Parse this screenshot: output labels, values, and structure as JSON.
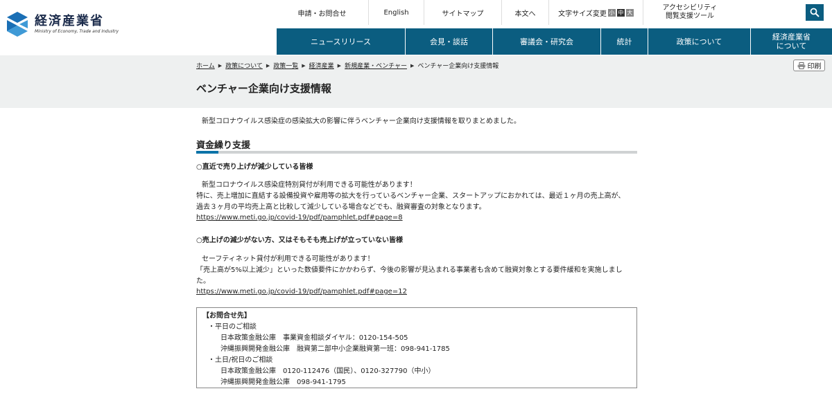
{
  "header": {
    "logo_ja": "経済産業省",
    "logo_en": "Ministry of Economy, Trade and Industry",
    "brand_color": "#0b5d80",
    "top_links": [
      {
        "label": "申請・お問合せ"
      },
      {
        "label": "English"
      },
      {
        "label": "サイトマップ"
      },
      {
        "label": "本文へ"
      }
    ],
    "font_size_label": "文字サイズ変更",
    "font_sizes": [
      "小",
      "中",
      "大"
    ],
    "accessibility_line1": "アクセシビリティ",
    "accessibility_line2": "閲覧支援ツール",
    "search_icon": "search-icon"
  },
  "main_nav": {
    "items": [
      {
        "label": "ニュースリリース"
      },
      {
        "label": "会見・談話"
      },
      {
        "label": "審議会・研究会"
      },
      {
        "label": "統計"
      },
      {
        "label": "政策について"
      },
      {
        "label_line1": "経済産業省",
        "label_line2": "について"
      }
    ]
  },
  "breadcrumb": {
    "items": [
      "ホーム",
      "政策について",
      "政策一覧",
      "経済産業",
      "新規産業・ベンチャー"
    ],
    "current": "ベンチャー企業向け支援情報"
  },
  "print_label": "印刷",
  "page_title": "ベンチャー企業向け支援情報",
  "lead": "新型コロナウイルス感染症の感染拡大の影響に伴うベンチャー企業向け支援情報を取りまとめました。",
  "section": {
    "title": "資金繰り支援",
    "block1": {
      "heading": "○直近で売り上げが減少している皆様",
      "line1": "新型コロナウイルス感染症特別貸付が利用できる可能性があります！",
      "line2": "特に、売上増加に直結する設備投資や雇用等の拡大を行っているベンチャー企業、スタートアップにおかれては、最近１ヶ月の売上高が、",
      "line3": "過去３ヶ月の平均売上高と比較して減少している場合などでも、融資審査の対象となります。",
      "link": "https://www.meti.go.jp/covid-19/pdf/pamphlet.pdf#page=8"
    },
    "block2": {
      "heading": "○売上げの減少がない方、又はそもそも売上げが立っていない皆様",
      "line1": "セーフティネット貸付が利用できる可能性があります！",
      "line2": "「売上高が5%以上減少」といった数値要件にかかわらず、今後の影響が見込まれる事業者も含めて融資対象とする要件緩和を実施しまし",
      "line3": "た。",
      "link": "https://www.meti.go.jp/covid-19/pdf/pamphlet.pdf#page=12"
    }
  },
  "contact": {
    "title": "【お問合せ先】",
    "weekday_label": "・平日のご相談",
    "weekday_1": "日本政策金融公庫　事業資金相談ダイヤル：0120-154-505",
    "weekday_2": "沖縄振興開発金融公庫　融資第二部中小企業融資第一班：098-941-1785",
    "holiday_label": "・土日/祝日のご相談",
    "holiday_1": "日本政策金融公庫　0120-112476（国民）、0120-327790（中小）",
    "holiday_2": "沖縄振興開発金融公庫　098-941-1795"
  }
}
